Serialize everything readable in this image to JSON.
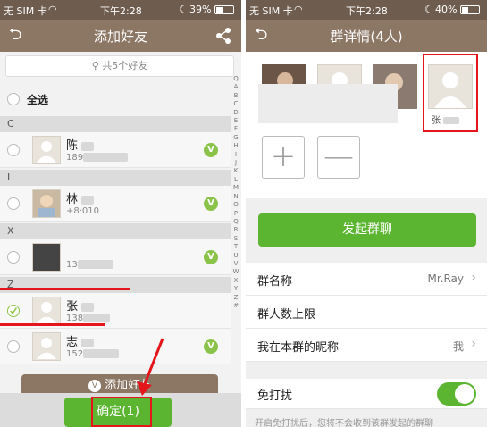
{
  "left": {
    "status": {
      "carrier": "无 SIM 卡",
      "time": "下午2:28",
      "battery": "39%",
      "battery_level": 0.39
    },
    "title": "添加好友",
    "search": {
      "placeholder": "共5个好友"
    },
    "select_all": "全选",
    "sections": [
      "C",
      "L",
      "X",
      "Z"
    ],
    "contacts": [
      {
        "name": "陈",
        "phone": "189",
        "checked": false
      },
      {
        "name": "林",
        "phone": "+8·010",
        "checked": false
      },
      {
        "name": "",
        "phone": "13",
        "checked": false
      },
      {
        "name": "张",
        "phone": "138",
        "checked": true
      },
      {
        "name": "志",
        "phone": "152",
        "checked": false
      }
    ],
    "badge": "V",
    "index_letters": [
      "Q",
      "A",
      "B",
      "C",
      "D",
      "E",
      "F",
      "G",
      "H",
      "I",
      "J",
      "K",
      "L",
      "M",
      "N",
      "O",
      "P",
      "Q",
      "R",
      "S",
      "T",
      "U",
      "V",
      "W",
      "X",
      "Y",
      "Z",
      "#"
    ],
    "add_button": "添加好友",
    "confirm_button": "确定(1)"
  },
  "right": {
    "status": {
      "carrier": "无 SIM 卡",
      "time": "下午2:28",
      "battery": "40%",
      "battery_level": 0.4
    },
    "title": "群详情(4人)",
    "member_names": [
      "",
      "",
      "",
      "张"
    ],
    "add_member": "+",
    "remove_member": "—",
    "start_chat": "发起群聊",
    "settings": [
      {
        "label": "群名称",
        "value": "Mr.Ray"
      },
      {
        "label": "群人数上限",
        "value": ""
      },
      {
        "label": "我在本群的昵称",
        "value": "我"
      }
    ],
    "dnd": {
      "label": "免打扰",
      "on": true
    },
    "dnd_hint": "开启免打扰后，您将不会收到该群发起的群聊"
  },
  "colors": {
    "brown_bar": "#8c7765",
    "green": "#5cb531",
    "badge": "#8bc34a",
    "annotation": "#e4161b"
  }
}
